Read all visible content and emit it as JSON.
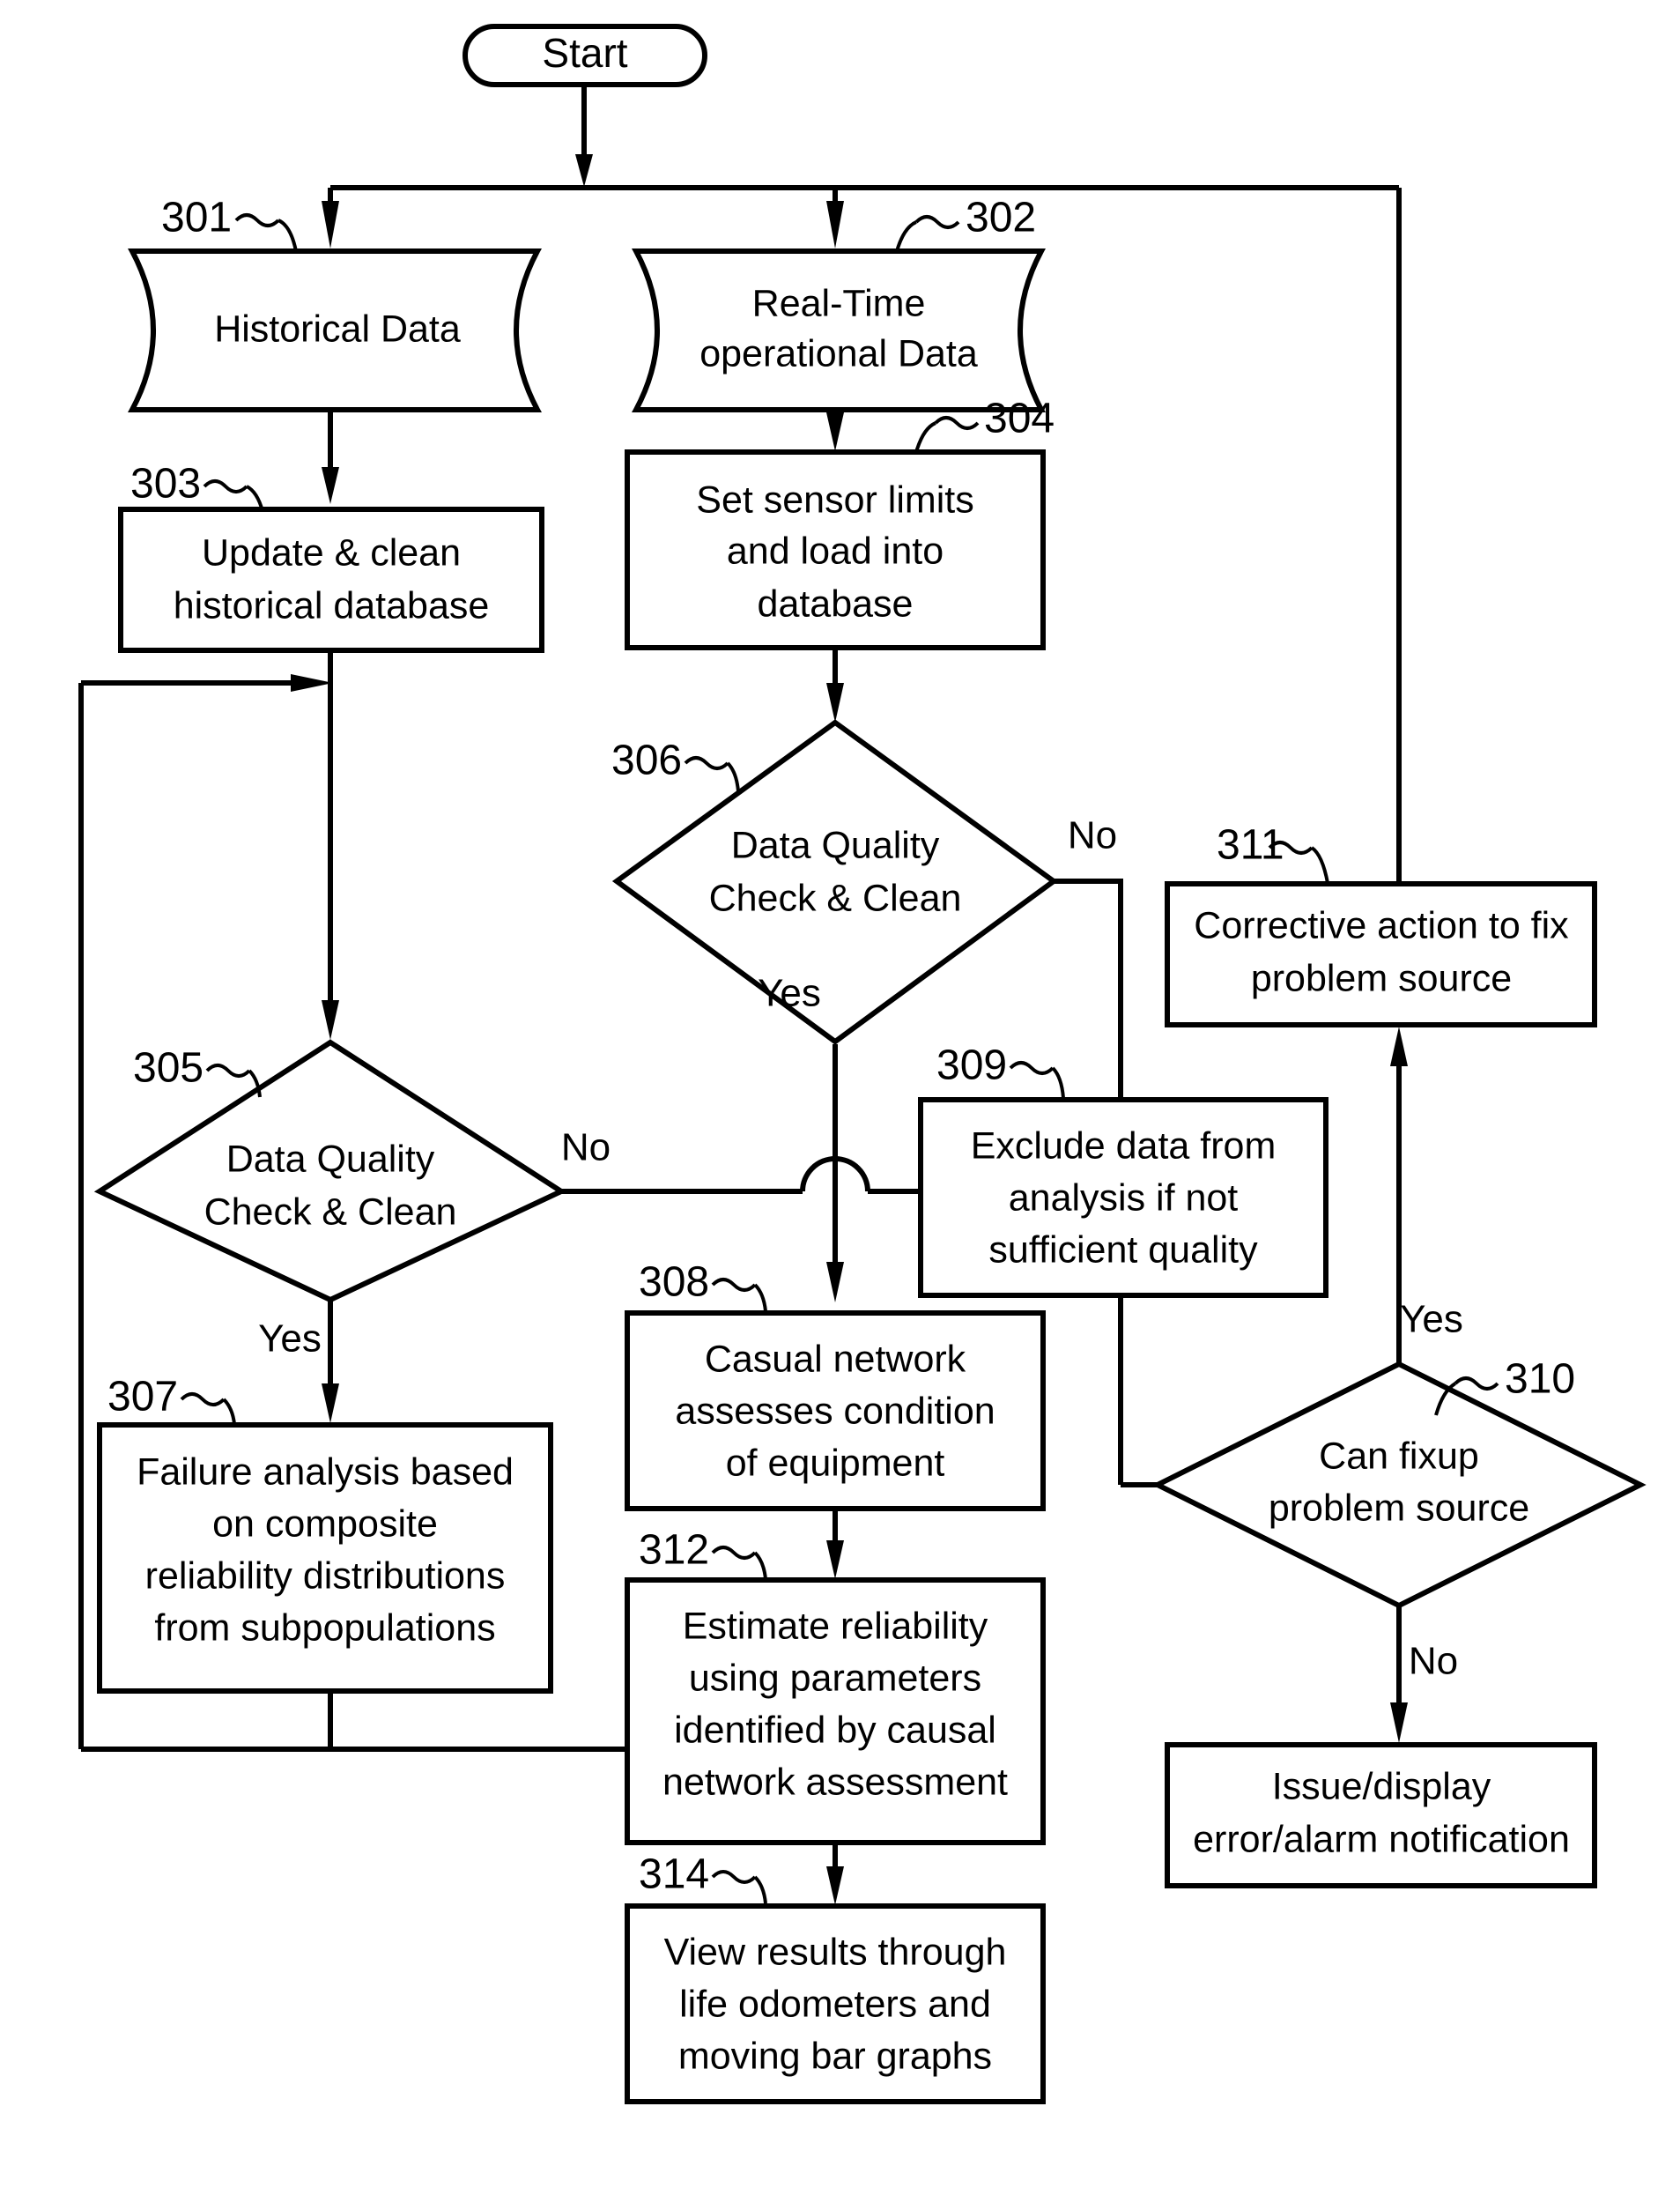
{
  "diagram": {
    "title": "Reliability assessment process flowchart",
    "stroke_color": "#000000",
    "background_color": "#ffffff"
  },
  "nodes": {
    "start": {
      "ref": "",
      "label": "Start",
      "shape": "terminator"
    },
    "n301": {
      "ref": "301",
      "label": "Historical Data",
      "shape": "document"
    },
    "n302": {
      "ref": "302",
      "label_line1": "Real-Time",
      "label_line2": "operational Data",
      "shape": "document"
    },
    "n303": {
      "ref": "303",
      "label_line1": "Update & clean",
      "label_line2": "historical database",
      "shape": "process"
    },
    "n304": {
      "ref": "304",
      "label_line1": "Set sensor limits",
      "label_line2": "and load into",
      "label_line3": "database",
      "shape": "process"
    },
    "n305": {
      "ref": "305",
      "label_line1": "Data Quality",
      "label_line2": "Check & Clean",
      "shape": "decision"
    },
    "n306": {
      "ref": "306",
      "label_line1": "Data Quality",
      "label_line2": "Check & Clean",
      "shape": "decision"
    },
    "n307": {
      "ref": "307",
      "label_line1": "Failure analysis based",
      "label_line2": "on composite",
      "label_line3": "reliability distributions",
      "label_line4": "from subpopulations",
      "shape": "process"
    },
    "n308": {
      "ref": "308",
      "label_line1": "Casual network",
      "label_line2": "assesses condition",
      "label_line3": "of equipment",
      "shape": "process"
    },
    "n309": {
      "ref": "309",
      "label_line1": "Exclude data from",
      "label_line2": "analysis if not",
      "label_line3": "sufficient quality",
      "shape": "process"
    },
    "n310": {
      "ref": "310",
      "label_line1": "Can fixup",
      "label_line2": "problem source",
      "shape": "decision"
    },
    "n311": {
      "ref": "311",
      "label_line1": "Corrective action to fix",
      "label_line2": "problem source",
      "shape": "process"
    },
    "n312": {
      "ref": "312",
      "label_line1": "Estimate reliability",
      "label_line2": "using parameters",
      "label_line3": "identified by causal",
      "label_line4": "network assessment",
      "shape": "process"
    },
    "n313": {
      "ref": "",
      "label_line1": "Issue/display",
      "label_line2": "error/alarm notification",
      "shape": "process"
    },
    "n314": {
      "ref": "314",
      "label_line1": "View results through",
      "label_line2": "life odometers and",
      "label_line3": "moving bar graphs",
      "shape": "process"
    }
  },
  "edge_labels": {
    "e306_no": "No",
    "e306_yes": "Yes",
    "e305_no": "No",
    "e305_yes": "Yes",
    "e310_yes": "Yes",
    "e310_no": "No"
  }
}
